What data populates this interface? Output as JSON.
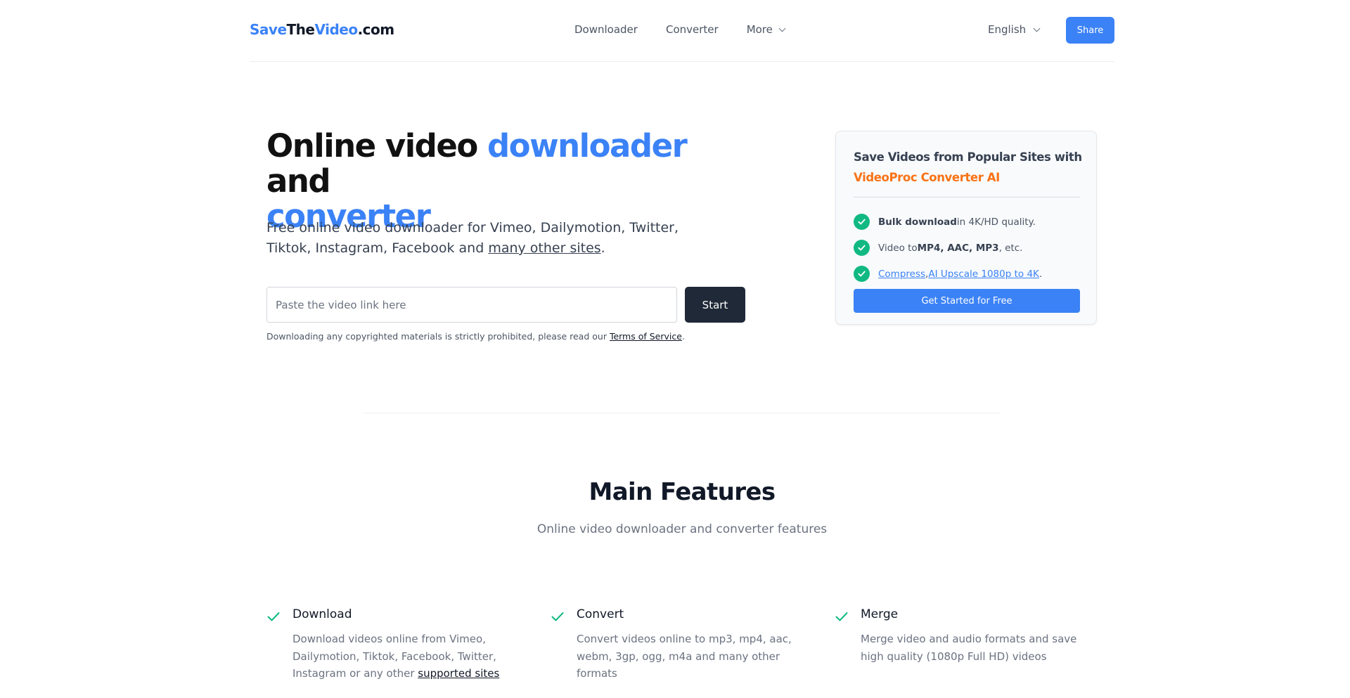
{
  "header": {
    "logo": {
      "part1": "Save",
      "part2": "The",
      "part3": "Video",
      "part4": ".com"
    },
    "nav": [
      {
        "label": "Downloader"
      },
      {
        "label": "Converter"
      },
      {
        "label": "More"
      }
    ],
    "language": "English",
    "share_label": "Share"
  },
  "hero": {
    "title": {
      "part1": "Online video ",
      "part2": "downloader",
      "part3": " and ",
      "part4": "converter"
    },
    "subtitle": {
      "text": "Free online video downloader for Vimeo, Dailymotion, Twitter, Tiktok, Instagram, Facebook and ",
      "link": "many other sites",
      "end": "."
    },
    "input_placeholder": "Paste the video link here",
    "start_label": "Start",
    "disclaimer": {
      "text": "Downloading any copyrighted materials is strictly prohibited, please read our ",
      "link": "Terms of Service",
      "end": "."
    }
  },
  "promo": {
    "title": "Save Videos from Popular Sites with ",
    "title_highlight": "VideoProc Converter AI",
    "items": [
      {
        "bold": "Bulk download",
        "text": " in 4K/HD quality."
      },
      {
        "pre": "Video to ",
        "bold": "MP4, AAC, MP3",
        "text": ", etc."
      },
      {
        "link1": "Compress",
        "sep": ", ",
        "link2": "AI Upscale 1080p to 4K",
        "end": "."
      }
    ],
    "button_label": "Get Started for Free"
  },
  "features": {
    "title": "Main Features",
    "subtitle": "Online video downloader and converter features",
    "items": [
      {
        "name": "Download",
        "desc": "Download videos online from Vimeo, Dailymotion, Tiktok, Facebook, Twitter, Instagram or any other ",
        "link": "supported sites"
      },
      {
        "name": "Convert",
        "desc": "Convert videos online to mp3, mp4, aac, webm, 3gp, ogg, m4a and many other formats"
      },
      {
        "name": "Merge",
        "desc": "Merge video and audio formats and save high quality (1080p Full HD) videos"
      }
    ]
  },
  "colors": {
    "accent": "#3b82f6",
    "dark_button": "#1f2937",
    "check": "#10b981",
    "highlight": "#f97316"
  }
}
